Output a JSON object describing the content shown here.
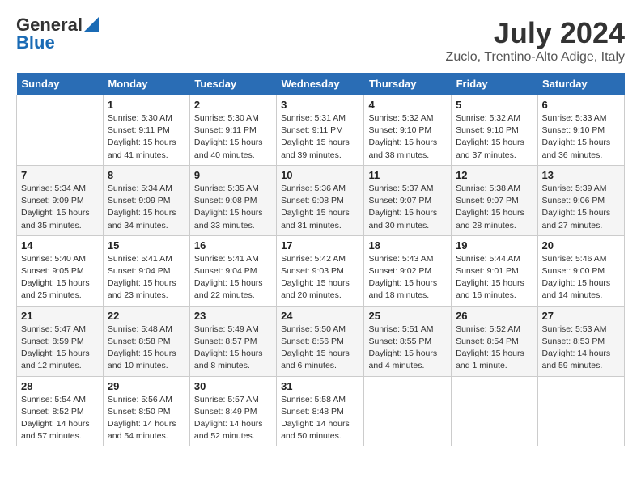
{
  "header": {
    "logo_general": "General",
    "logo_blue": "Blue",
    "month": "July 2024",
    "location": "Zuclo, Trentino-Alto Adige, Italy"
  },
  "days_of_week": [
    "Sunday",
    "Monday",
    "Tuesday",
    "Wednesday",
    "Thursday",
    "Friday",
    "Saturday"
  ],
  "weeks": [
    [
      {
        "num": "",
        "sunrise": "",
        "sunset": "",
        "daylight": ""
      },
      {
        "num": "1",
        "sunrise": "Sunrise: 5:30 AM",
        "sunset": "Sunset: 9:11 PM",
        "daylight": "Daylight: 15 hours and 41 minutes."
      },
      {
        "num": "2",
        "sunrise": "Sunrise: 5:30 AM",
        "sunset": "Sunset: 9:11 PM",
        "daylight": "Daylight: 15 hours and 40 minutes."
      },
      {
        "num": "3",
        "sunrise": "Sunrise: 5:31 AM",
        "sunset": "Sunset: 9:11 PM",
        "daylight": "Daylight: 15 hours and 39 minutes."
      },
      {
        "num": "4",
        "sunrise": "Sunrise: 5:32 AM",
        "sunset": "Sunset: 9:10 PM",
        "daylight": "Daylight: 15 hours and 38 minutes."
      },
      {
        "num": "5",
        "sunrise": "Sunrise: 5:32 AM",
        "sunset": "Sunset: 9:10 PM",
        "daylight": "Daylight: 15 hours and 37 minutes."
      },
      {
        "num": "6",
        "sunrise": "Sunrise: 5:33 AM",
        "sunset": "Sunset: 9:10 PM",
        "daylight": "Daylight: 15 hours and 36 minutes."
      }
    ],
    [
      {
        "num": "7",
        "sunrise": "Sunrise: 5:34 AM",
        "sunset": "Sunset: 9:09 PM",
        "daylight": "Daylight: 15 hours and 35 minutes."
      },
      {
        "num": "8",
        "sunrise": "Sunrise: 5:34 AM",
        "sunset": "Sunset: 9:09 PM",
        "daylight": "Daylight: 15 hours and 34 minutes."
      },
      {
        "num": "9",
        "sunrise": "Sunrise: 5:35 AM",
        "sunset": "Sunset: 9:08 PM",
        "daylight": "Daylight: 15 hours and 33 minutes."
      },
      {
        "num": "10",
        "sunrise": "Sunrise: 5:36 AM",
        "sunset": "Sunset: 9:08 PM",
        "daylight": "Daylight: 15 hours and 31 minutes."
      },
      {
        "num": "11",
        "sunrise": "Sunrise: 5:37 AM",
        "sunset": "Sunset: 9:07 PM",
        "daylight": "Daylight: 15 hours and 30 minutes."
      },
      {
        "num": "12",
        "sunrise": "Sunrise: 5:38 AM",
        "sunset": "Sunset: 9:07 PM",
        "daylight": "Daylight: 15 hours and 28 minutes."
      },
      {
        "num": "13",
        "sunrise": "Sunrise: 5:39 AM",
        "sunset": "Sunset: 9:06 PM",
        "daylight": "Daylight: 15 hours and 27 minutes."
      }
    ],
    [
      {
        "num": "14",
        "sunrise": "Sunrise: 5:40 AM",
        "sunset": "Sunset: 9:05 PM",
        "daylight": "Daylight: 15 hours and 25 minutes."
      },
      {
        "num": "15",
        "sunrise": "Sunrise: 5:41 AM",
        "sunset": "Sunset: 9:04 PM",
        "daylight": "Daylight: 15 hours and 23 minutes."
      },
      {
        "num": "16",
        "sunrise": "Sunrise: 5:41 AM",
        "sunset": "Sunset: 9:04 PM",
        "daylight": "Daylight: 15 hours and 22 minutes."
      },
      {
        "num": "17",
        "sunrise": "Sunrise: 5:42 AM",
        "sunset": "Sunset: 9:03 PM",
        "daylight": "Daylight: 15 hours and 20 minutes."
      },
      {
        "num": "18",
        "sunrise": "Sunrise: 5:43 AM",
        "sunset": "Sunset: 9:02 PM",
        "daylight": "Daylight: 15 hours and 18 minutes."
      },
      {
        "num": "19",
        "sunrise": "Sunrise: 5:44 AM",
        "sunset": "Sunset: 9:01 PM",
        "daylight": "Daylight: 15 hours and 16 minutes."
      },
      {
        "num": "20",
        "sunrise": "Sunrise: 5:46 AM",
        "sunset": "Sunset: 9:00 PM",
        "daylight": "Daylight: 15 hours and 14 minutes."
      }
    ],
    [
      {
        "num": "21",
        "sunrise": "Sunrise: 5:47 AM",
        "sunset": "Sunset: 8:59 PM",
        "daylight": "Daylight: 15 hours and 12 minutes."
      },
      {
        "num": "22",
        "sunrise": "Sunrise: 5:48 AM",
        "sunset": "Sunset: 8:58 PM",
        "daylight": "Daylight: 15 hours and 10 minutes."
      },
      {
        "num": "23",
        "sunrise": "Sunrise: 5:49 AM",
        "sunset": "Sunset: 8:57 PM",
        "daylight": "Daylight: 15 hours and 8 minutes."
      },
      {
        "num": "24",
        "sunrise": "Sunrise: 5:50 AM",
        "sunset": "Sunset: 8:56 PM",
        "daylight": "Daylight: 15 hours and 6 minutes."
      },
      {
        "num": "25",
        "sunrise": "Sunrise: 5:51 AM",
        "sunset": "Sunset: 8:55 PM",
        "daylight": "Daylight: 15 hours and 4 minutes."
      },
      {
        "num": "26",
        "sunrise": "Sunrise: 5:52 AM",
        "sunset": "Sunset: 8:54 PM",
        "daylight": "Daylight: 15 hours and 1 minute."
      },
      {
        "num": "27",
        "sunrise": "Sunrise: 5:53 AM",
        "sunset": "Sunset: 8:53 PM",
        "daylight": "Daylight: 14 hours and 59 minutes."
      }
    ],
    [
      {
        "num": "28",
        "sunrise": "Sunrise: 5:54 AM",
        "sunset": "Sunset: 8:52 PM",
        "daylight": "Daylight: 14 hours and 57 minutes."
      },
      {
        "num": "29",
        "sunrise": "Sunrise: 5:56 AM",
        "sunset": "Sunset: 8:50 PM",
        "daylight": "Daylight: 14 hours and 54 minutes."
      },
      {
        "num": "30",
        "sunrise": "Sunrise: 5:57 AM",
        "sunset": "Sunset: 8:49 PM",
        "daylight": "Daylight: 14 hours and 52 minutes."
      },
      {
        "num": "31",
        "sunrise": "Sunrise: 5:58 AM",
        "sunset": "Sunset: 8:48 PM",
        "daylight": "Daylight: 14 hours and 50 minutes."
      },
      {
        "num": "",
        "sunrise": "",
        "sunset": "",
        "daylight": ""
      },
      {
        "num": "",
        "sunrise": "",
        "sunset": "",
        "daylight": ""
      },
      {
        "num": "",
        "sunrise": "",
        "sunset": "",
        "daylight": ""
      }
    ]
  ]
}
